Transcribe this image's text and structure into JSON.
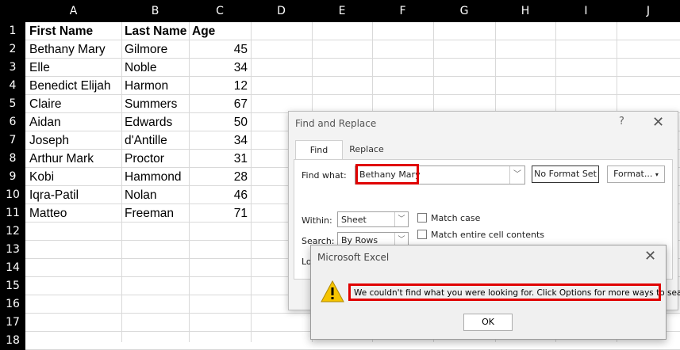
{
  "columns": [
    "A",
    "B",
    "C",
    "D",
    "E",
    "F",
    "G",
    "H",
    "I",
    "J"
  ],
  "rows": [
    "1",
    "2",
    "3",
    "4",
    "5",
    "6",
    "7",
    "8",
    "9",
    "10",
    "11",
    "12",
    "13",
    "14",
    "15",
    "16",
    "17",
    "18"
  ],
  "headers": {
    "first_name": "First Name",
    "last_name": "Last Name",
    "age": "Age"
  },
  "people": [
    {
      "first": "Bethany  Mary",
      "last": "Gilmore",
      "age": "45"
    },
    {
      "first": "Elle",
      "last": "Noble",
      "age": "34"
    },
    {
      "first": "Benedict Elijah",
      "last": "Harmon",
      "age": "12"
    },
    {
      "first": "Claire",
      "last": "Summers",
      "age": "67"
    },
    {
      "first": "Aidan",
      "last": "Edwards",
      "age": "50"
    },
    {
      "first": "Joseph",
      "last": "d'Antille",
      "age": "34"
    },
    {
      "first": "Arthur Mark",
      "last": "Proctor",
      "age": "31"
    },
    {
      "first": "Kobi",
      "last": "Hammond",
      "age": "28"
    },
    {
      "first": "Iqra-Patil",
      "last": "Nolan",
      "age": "46"
    },
    {
      "first": "Matteo",
      "last": "Freeman",
      "age": "71"
    }
  ],
  "find_replace": {
    "title": "Find and Replace",
    "help": "?",
    "tab_find": "Find",
    "tab_replace": "Replace",
    "find_what_label": "Find what:",
    "find_what_value": "Bethany Mary",
    "no_format": "No Format Set",
    "format_btn": "Format...",
    "within_label": "Within:",
    "within_value": "Sheet",
    "search_label": "Search:",
    "search_value": "By Rows",
    "look_label": "Lo",
    "match_case": "Match case",
    "match_entire": "Match entire cell contents"
  },
  "message_box": {
    "title": "Microsoft Excel",
    "message": "We couldn't find what you were looking for. Click Options for more ways to search.",
    "ok": "OK"
  },
  "colors": {
    "highlight": "#e00000",
    "warning": "#f5c400"
  }
}
